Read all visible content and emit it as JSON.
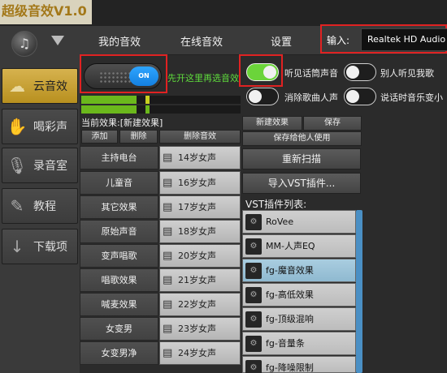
{
  "app_title": "超级音效V1.0",
  "sidebar": {
    "items": [
      {
        "label": "云音效",
        "icon": "cloud-icon",
        "active": true
      },
      {
        "label": "喝彩声",
        "icon": "applause-icon",
        "active": false
      },
      {
        "label": "录音室",
        "icon": "microphone-icon",
        "active": false
      },
      {
        "label": "教程",
        "icon": "tutorial-icon",
        "active": false
      },
      {
        "label": "下载项",
        "icon": "download-icon",
        "active": false
      }
    ]
  },
  "menu": {
    "tabs": [
      "我的音效",
      "在线音效",
      "设置"
    ],
    "input_label": "输入:",
    "device": "Realtek HD Audio Mi"
  },
  "toggle": {
    "state_label": "ON",
    "hint": "先开这里再选音效"
  },
  "options": {
    "hear_mic": "听见话筒声音",
    "others_hear_me": "别人听见我歌",
    "remove_vocals": "消除歌曲人声",
    "duck_music": "说话时音乐变小"
  },
  "effects": {
    "current_label": "当前效果:[新建效果]",
    "add_label": "添加",
    "delete_label": "删除",
    "delete_sound_label": "删除音效",
    "rows": [
      {
        "name": "主持电台",
        "preset": "14岁女声"
      },
      {
        "name": "儿童音",
        "preset": "16岁女声"
      },
      {
        "name": "其它效果",
        "preset": "17岁女声"
      },
      {
        "name": "原始声音",
        "preset": "18岁女声"
      },
      {
        "name": "变声唱歌",
        "preset": "20岁女声"
      },
      {
        "name": "唱歌效果",
        "preset": "21岁女声"
      },
      {
        "name": "喊麦效果",
        "preset": "22岁女声"
      },
      {
        "name": "女变男",
        "preset": "23岁女声"
      },
      {
        "name": "女变男净",
        "preset": "24岁女声"
      }
    ]
  },
  "middle": {
    "new_effect": "新建效果",
    "save": "保存",
    "save_for_others": "保存给他人使用",
    "rescan": "重新扫描",
    "import_vst": "导入VST插件...",
    "vst_list_title": "VST插件列表:",
    "vst_items": [
      "RoVee",
      "MM-人声EQ",
      "fg-魔音效果",
      "fg-高低效果",
      "fg-顶级混响",
      "fg-音量条",
      "fg-降噪限制"
    ],
    "vst_selected_index": 2
  },
  "colors": {
    "accent_gold": "#c9a53a",
    "toggle_blue": "#1e90ff",
    "mic_on_green": "#6bd43a",
    "hint_green": "#5fdc3c",
    "highlight_red": "#e02222"
  }
}
